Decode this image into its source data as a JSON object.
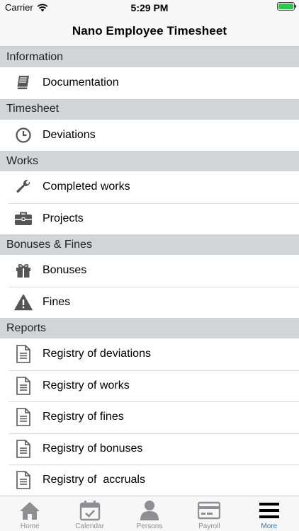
{
  "status_bar": {
    "carrier": "Carrier",
    "time": "5:29 PM",
    "battery_level": 1.0
  },
  "nav": {
    "title": "Nano Employee Timesheet"
  },
  "sections": [
    {
      "header": "Information",
      "items": [
        {
          "label": "Documentation",
          "icon": "book-icon"
        }
      ]
    },
    {
      "header": "Timesheet",
      "items": [
        {
          "label": "Deviations",
          "icon": "clock-icon"
        }
      ]
    },
    {
      "header": "Works",
      "items": [
        {
          "label": "Completed works",
          "icon": "wrench-icon"
        },
        {
          "label": "Projects",
          "icon": "briefcase-icon"
        }
      ]
    },
    {
      "header": "Bonuses & Fines",
      "items": [
        {
          "label": "Bonuses",
          "icon": "gift-icon"
        },
        {
          "label": "Fines",
          "icon": "warning-icon"
        }
      ]
    },
    {
      "header": "Reports",
      "items": [
        {
          "label": "Registry of deviations",
          "icon": "document-icon"
        },
        {
          "label": "Registry of works",
          "icon": "document-icon"
        },
        {
          "label": "Registry of fines",
          "icon": "document-icon"
        },
        {
          "label": "Registry of bonuses",
          "icon": "document-icon"
        },
        {
          "label": "Registry of  accruals",
          "icon": "document-icon"
        }
      ]
    }
  ],
  "tab_bar": {
    "tabs": [
      {
        "label": "Home",
        "icon": "home-icon"
      },
      {
        "label": "Calendar",
        "icon": "calendar-icon"
      },
      {
        "label": "Persons",
        "icon": "person-icon"
      },
      {
        "label": "Payroll",
        "icon": "credit-card-icon"
      },
      {
        "label": "More",
        "icon": "menu-icon"
      }
    ],
    "active_tab": "More"
  },
  "colors": {
    "accent": "#1a7ad8",
    "section_bg": "#d2d5d8",
    "inactive_tab": "#8e8e93",
    "icon": "#555555",
    "battery": "#2dc84d"
  }
}
